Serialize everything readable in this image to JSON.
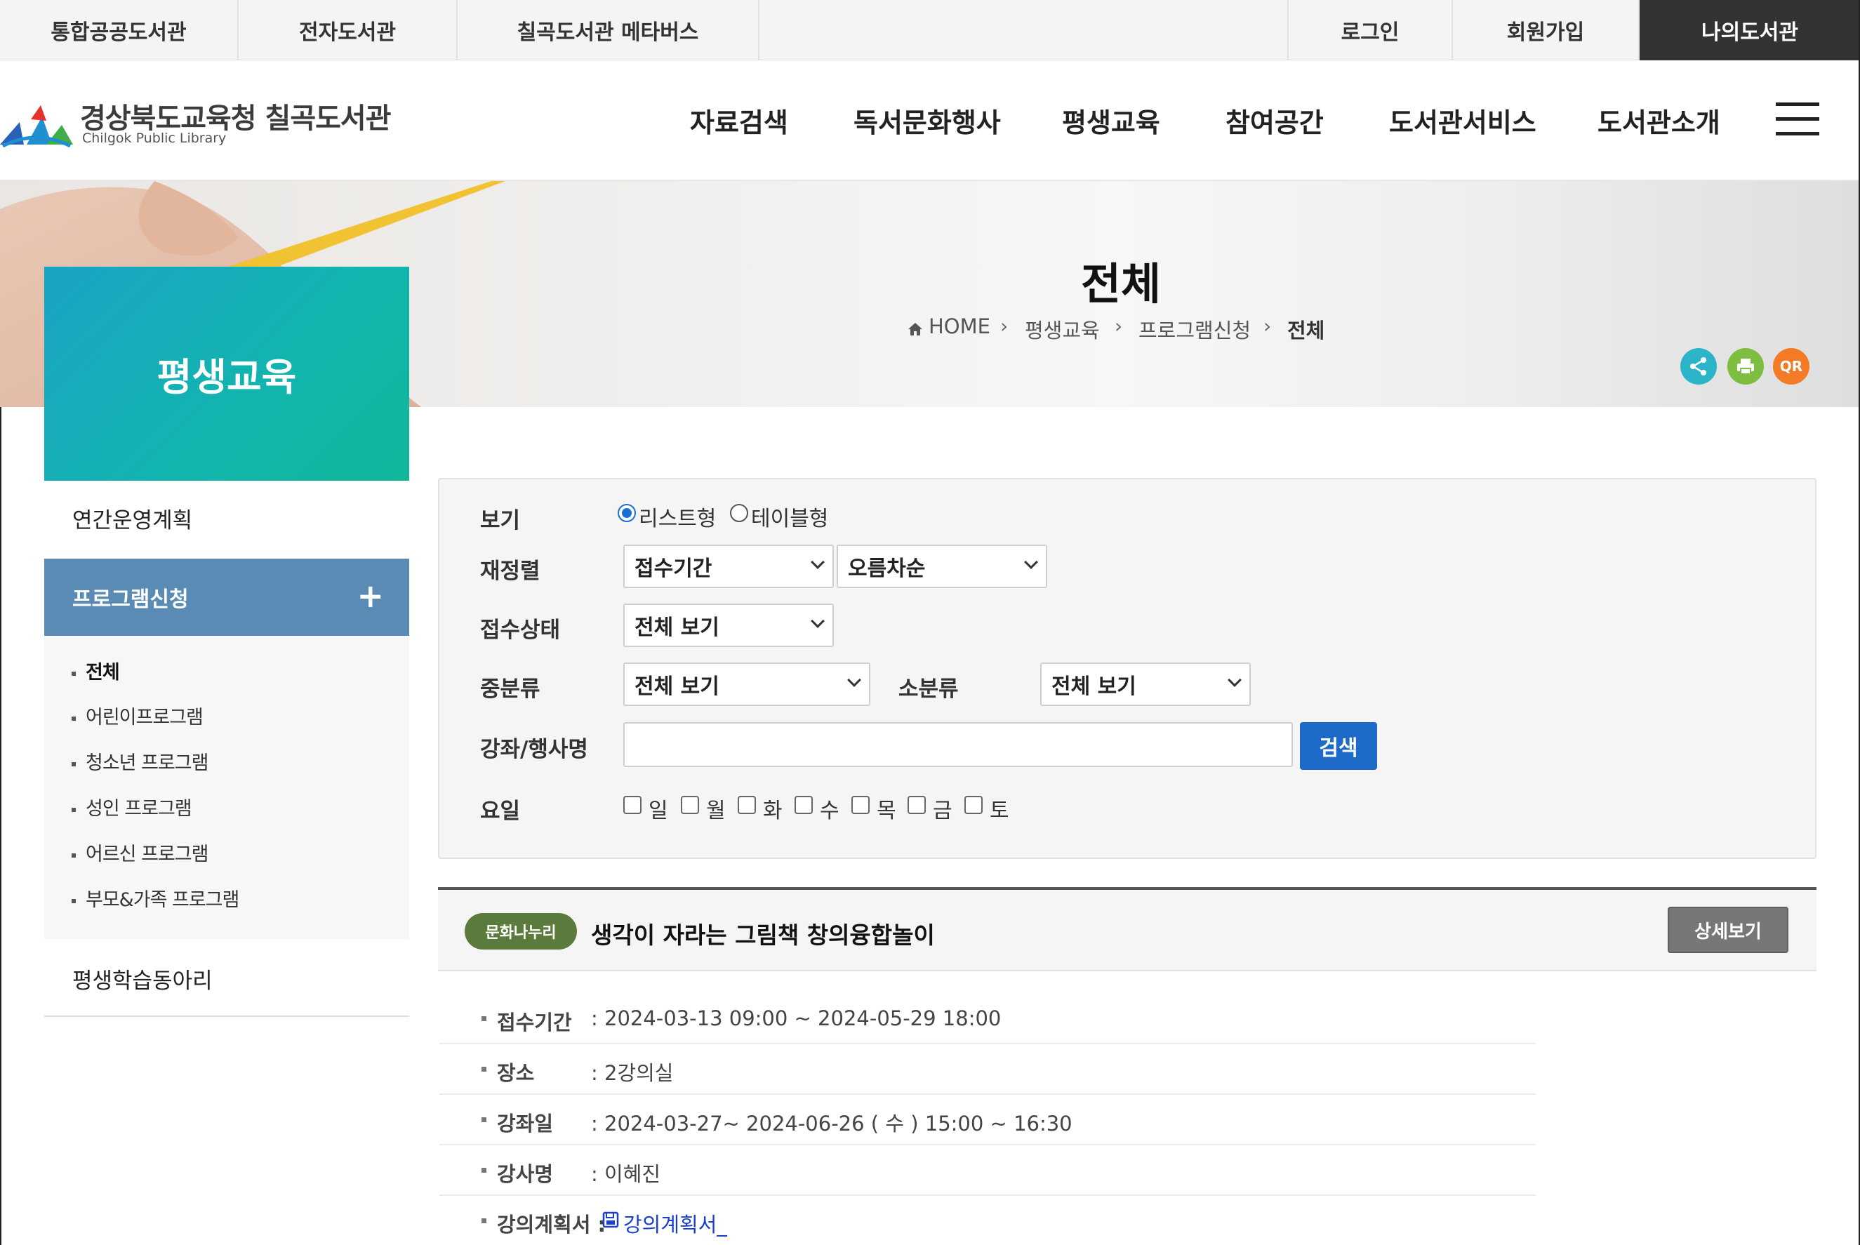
{
  "topbar": {
    "left": [
      "통합공공도서관",
      "전자도서관",
      "칠곡도서관 메타버스"
    ],
    "login": "로그인",
    "join": "회원가입",
    "mylib": "나의도서관"
  },
  "header": {
    "logo_ko": "경상북도교육청 칠곡도서관",
    "logo_en": "Chilgok Public Library",
    "nav": [
      "자료검색",
      "독서문화행사",
      "평생교육",
      "참여공간",
      "도서관서비스",
      "도서관소개"
    ]
  },
  "banner": {
    "title": "전체",
    "breadcrumb": [
      "HOME",
      "평생교육",
      "프로그램신청",
      "전체"
    ],
    "qr": "QR"
  },
  "sidebar": {
    "title": "평생교육",
    "item1": "연간운영계획",
    "active": "프로그램신청",
    "active_plus": "+",
    "sub": [
      "전체",
      "어린이프로그램",
      "청소년 프로그램",
      "성인 프로그램",
      "어르신 프로그램",
      "부모&가족 프로그램"
    ],
    "item3": "평생학습동아리"
  },
  "search": {
    "view_label": "보기",
    "view_opt1": "리스트형",
    "view_opt2": "테이블형",
    "sort_label": "재정렬",
    "sort1": "접수기간",
    "sort2": "오름차순",
    "status_label": "접수상태",
    "status_value": "전체 보기",
    "mid_label": "중분류",
    "mid_value": "전체 보기",
    "small_label": "소분류",
    "small_value": "전체 보기",
    "name_label": "강좌/행사명",
    "name_value": "",
    "search_btn": "검색",
    "day_label": "요일",
    "days": [
      "일",
      "월",
      "화",
      "수",
      "목",
      "금",
      "토"
    ]
  },
  "result": {
    "badge": "문화나누리",
    "title": "생각이 자라는 그림책 창의융합놀이",
    "detail_btn": "상세보기",
    "rows": [
      {
        "label": "접수기간",
        "value": ": 2024-03-13  09:00   ~    2024-05-29  18:00"
      },
      {
        "label": "장소",
        "value": ": 2강의실"
      },
      {
        "label": "강좌일",
        "value": ": 2024-03-27~ 2024-06-26 ( 수 ) 15:00 ~ 16:30"
      },
      {
        "label": "강사명",
        "value": ": 이혜진"
      }
    ],
    "plan_label": "강의계획서 :",
    "plan_link": "강의계획서_"
  }
}
